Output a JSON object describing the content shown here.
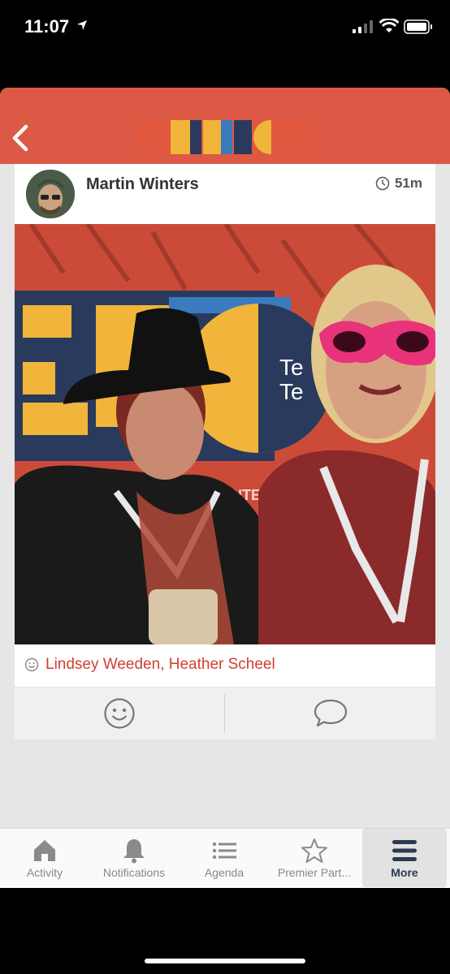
{
  "status_bar": {
    "time": "11:07"
  },
  "header": {
    "logo_text": "TETC"
  },
  "post": {
    "author": "Martin Winters",
    "time_ago": "51m",
    "photo_text": {
      "banner_partial": "ENTED",
      "sign_line1": "Te",
      "sign_line2": "Te"
    },
    "tagged": "Lindsey Weeden, Heather Scheel"
  },
  "tabs": [
    {
      "label": "Activity",
      "icon": "home-icon"
    },
    {
      "label": "Notifications",
      "icon": "bell-icon"
    },
    {
      "label": "Agenda",
      "icon": "list-icon"
    },
    {
      "label": "Premier Part...",
      "icon": "star-icon"
    },
    {
      "label": "More",
      "icon": "menu-icon",
      "active": true
    }
  ],
  "colors": {
    "header": "#dc5a45",
    "accent": "#d0402f",
    "active_tab": "#2b3a4e"
  }
}
